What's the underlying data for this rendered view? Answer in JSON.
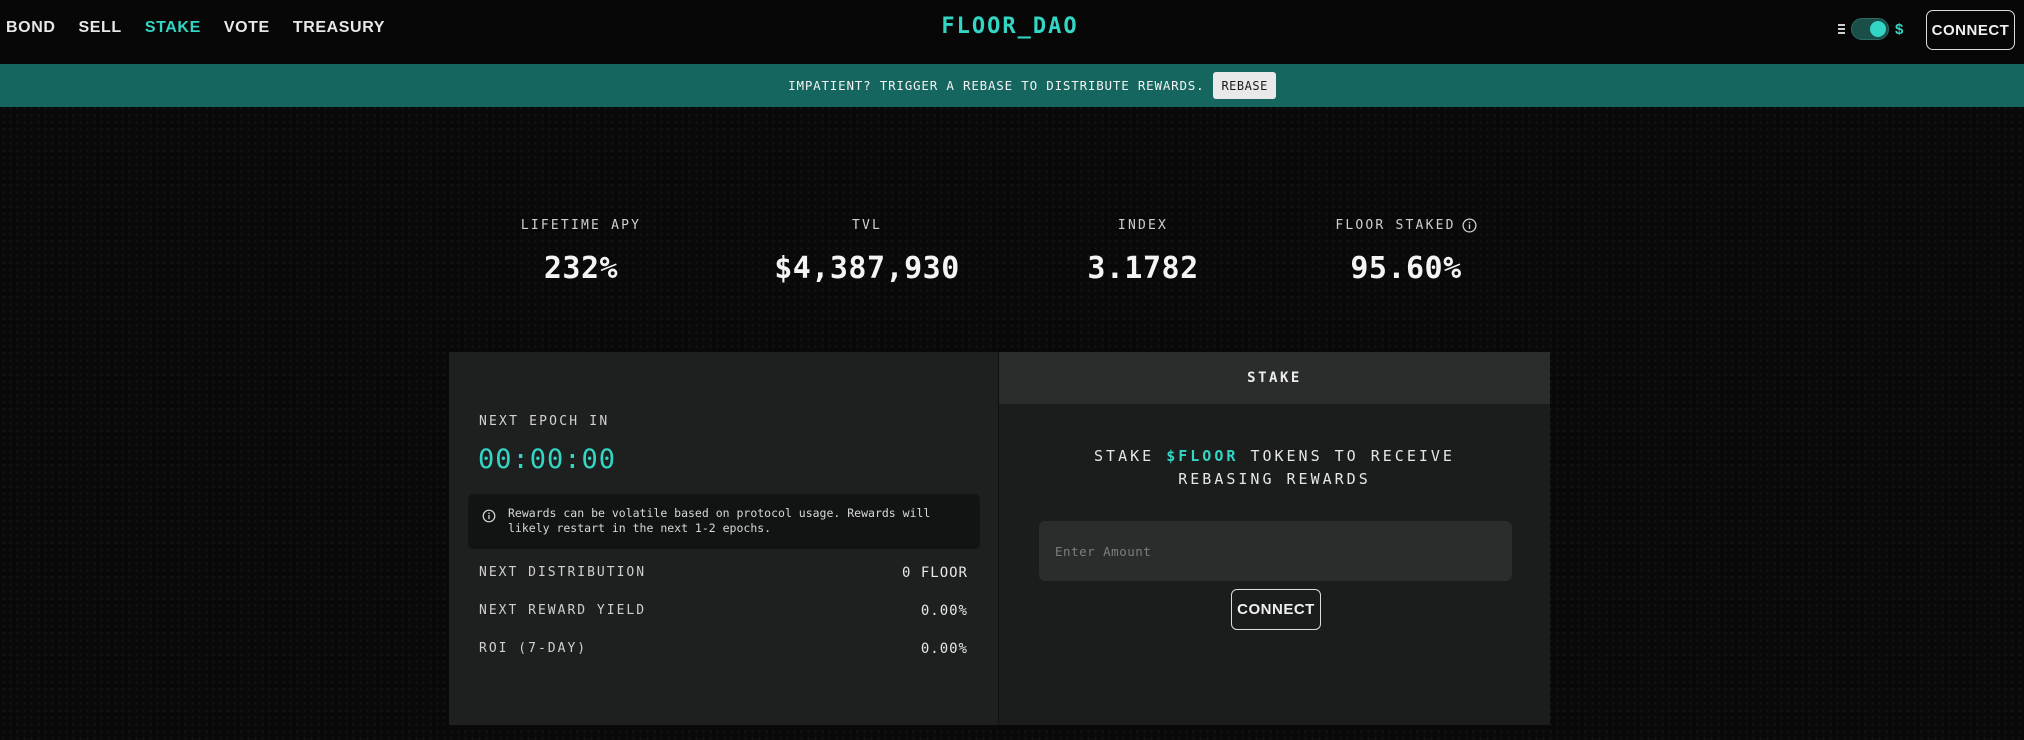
{
  "nav": {
    "items": [
      {
        "label": "BOND"
      },
      {
        "label": "SELL"
      },
      {
        "label": "STAKE",
        "active": true
      },
      {
        "label": "VOTE"
      },
      {
        "label": "TREASURY"
      }
    ]
  },
  "header": {
    "logo": "FLOOR_DAO",
    "currency_toggle": {
      "symbol": "$",
      "icon": "list-icon",
      "state": "on"
    },
    "connect_label": "CONNECT"
  },
  "banner": {
    "text": "IMPATIENT? TRIGGER A REBASE TO DISTRIBUTE REWARDS.",
    "button_label": "REBASE"
  },
  "stats": [
    {
      "label": "LIFETIME APY",
      "value": "232%"
    },
    {
      "label": "TVL",
      "value": "$4,387,930"
    },
    {
      "label": "INDEX",
      "value": "3.1782"
    },
    {
      "label": "FLOOR STAKED",
      "value": "95.60%",
      "icon": "info-icon"
    }
  ],
  "epoch": {
    "label": "NEXT EPOCH IN",
    "timer": "00:00:00",
    "notice": "Rewards can be volatile based on protocol usage. Rewards will likely restart in the next 1-2 epochs."
  },
  "rewards": [
    {
      "label": "NEXT DISTRIBUTION",
      "value": "0 FLOOR"
    },
    {
      "label": "NEXT REWARD YIELD",
      "value": "0.00%"
    },
    {
      "label": "ROI (7-DAY)",
      "value": "0.00%"
    }
  ],
  "stake": {
    "tab_label": "STAKE",
    "heading_prefix": "STAKE",
    "heading_token": "$FLOOR",
    "heading_suffix": "TOKENS TO RECEIVE",
    "heading_line2": "REBASING REWARDS",
    "input_placeholder": "Enter Amount",
    "button_label": "CONNECT"
  },
  "colors": {
    "accent": "#33d6c4",
    "banner": "#166660",
    "background": "#090909",
    "panel": "#1e1f1f"
  }
}
